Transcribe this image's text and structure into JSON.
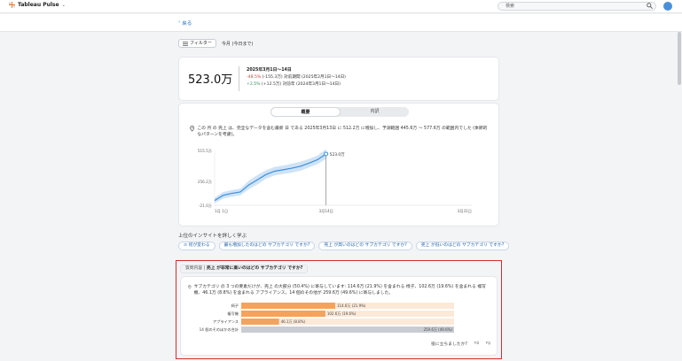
{
  "app": {
    "name": "Tableau Pulse"
  },
  "search": {
    "placeholder": "検索"
  },
  "nav": {
    "back_label": "戻る"
  },
  "filters": {
    "filter_label": "フィルター",
    "period_label": "今月 (今日まで)"
  },
  "metric": {
    "value": "523.0万",
    "range_title": "2025年3月1日〜14日",
    "prev_change": "-48.5%",
    "prev_text": "(-155.3万) 対前期間 (2025年2月1日〜14日)",
    "yoy_change": "+2.5%",
    "yoy_text": "(+12.5万) 対前年 (2024年3月1日〜14日)"
  },
  "tabs": {
    "summary": "概要",
    "detail": "内訳"
  },
  "insight": {
    "text": "この 月 の 売上 は、完全なデータを含む最新 日 である 2025年3月13日 に 512.2万 に増加し、予測範囲 445.6万 〜 577.6万 の範囲内でした (季節的なパターンを考慮)。"
  },
  "chart_data": {
    "type": "line",
    "x_tick_labels": [
      "1月 1日",
      "3月14日",
      "3月31日"
    ],
    "y_tick_labels": [
      "-21.0万",
      "256.2万",
      "515.5万"
    ],
    "end_label": "523.0万",
    "x": [
      1,
      2,
      3,
      4,
      5,
      6,
      7,
      8,
      9,
      10,
      11,
      12,
      13,
      14
    ],
    "values": [
      30,
      85,
      105,
      120,
      195,
      250,
      305,
      340,
      355,
      372,
      392,
      425,
      462,
      523
    ],
    "band_low": [
      0,
      50,
      70,
      85,
      150,
      200,
      260,
      295,
      310,
      325,
      345,
      380,
      415,
      470
    ],
    "band_high": [
      60,
      120,
      140,
      155,
      240,
      300,
      350,
      385,
      400,
      420,
      440,
      470,
      505,
      575
    ],
    "xlim": [
      1,
      31
    ],
    "ylim": [
      -21,
      560
    ],
    "colors": {
      "line": "#3d8fd9",
      "band": "#cfe3f7"
    }
  },
  "learn_more": {
    "title": "上位のインサイトを詳しく学ぶ",
    "chips": [
      "何が変わる",
      "最も増加したのはどの サブカテゴリ ですか?",
      "売上 が高いのはどの サブカテゴリ ですか?",
      "売上 が低いのはどの サブカテゴリ ですか?"
    ]
  },
  "question": {
    "prefix": "質問内容",
    "sep": "|",
    "text": "売上 が非常に高いのはどの サブカテゴリ ですか?"
  },
  "answer": {
    "text": "サブカテゴリ の 3 つの要素だけが、売上 の大部分 (50.4%) に寄与しています: 114.6万 (21.9%) を含まれる 椅子、102.6万 (19.6%) を含まれる 複写機、46.1万 (8.8%) を含まれる アプライアンス。14 個のその他が 259.6万 (49.6%) に寄与しました。"
  },
  "bars": {
    "labels": [
      "椅子",
      "複写機",
      "アプライアンス",
      "14 個のそのほかの合計"
    ],
    "values": [
      114.6,
      102.6,
      46.1,
      259.6
    ],
    "value_labels": [
      "114.6万 (21.9%)",
      "102.6万 (19.6%)",
      "46.1万 (8.8%)",
      "259.6万 (49.6%)"
    ],
    "max": 259.6,
    "colors": {
      "top": "#f5a35c",
      "other": "#c9cdd3",
      "bg": "#fde9d8"
    }
  },
  "feedback": {
    "question": "役に立ちましたか?"
  }
}
